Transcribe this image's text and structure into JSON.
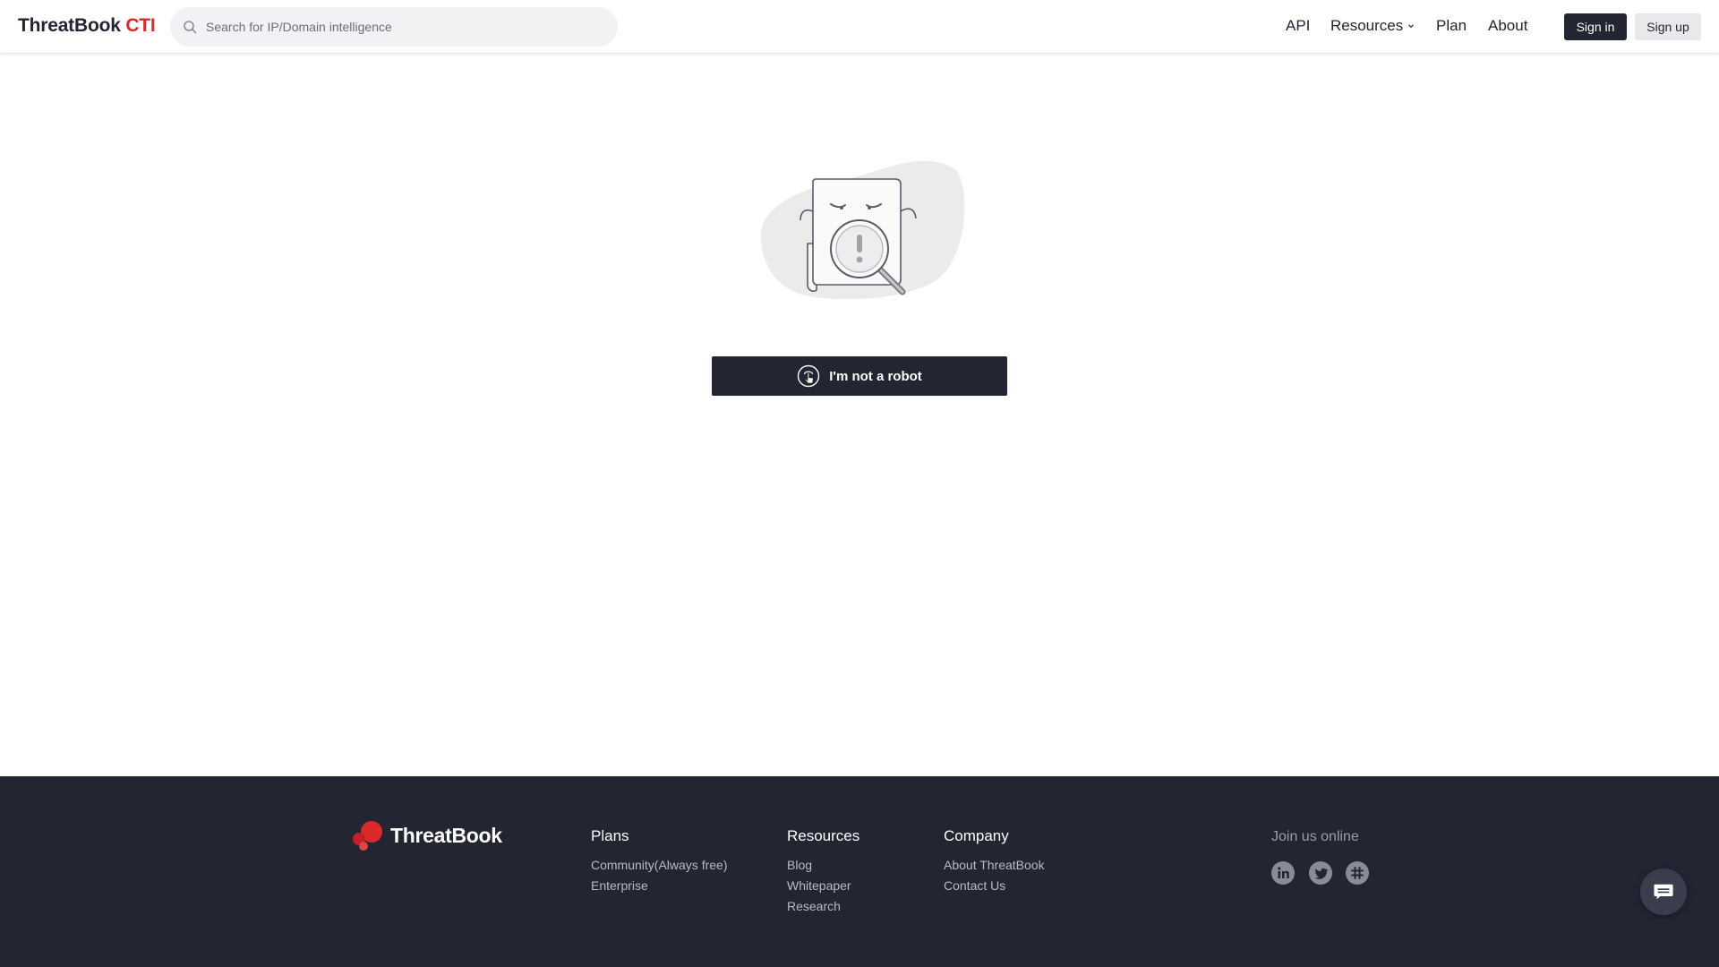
{
  "header": {
    "brand_main": "ThreatBook",
    "brand_accent": "CTI",
    "search_placeholder": "Search for IP/Domain intelligence",
    "nav": {
      "api": "API",
      "resources": "Resources",
      "plan": "Plan",
      "about": "About"
    },
    "signin_label": "Sign in",
    "signup_label": "Sign up"
  },
  "main": {
    "illustration_icon": "document-magnifier-warning",
    "robot_button_label": "I'm not a robot",
    "robot_button_icon": "pointer-hand-icon"
  },
  "footer": {
    "logo_text": "ThreatBook",
    "plans": {
      "title": "Plans",
      "links": [
        "Community(Always free)",
        "Enterprise"
      ]
    },
    "resources": {
      "title": "Resources",
      "links": [
        "Blog",
        "Whitepaper",
        "Research"
      ]
    },
    "company": {
      "title": "Company",
      "links": [
        "About ThreatBook",
        "Contact Us"
      ]
    },
    "join_label": "Join us online",
    "social_icons": [
      "linkedin-icon",
      "twitter-icon",
      "slack-icon"
    ]
  },
  "colors": {
    "dark": "#232533",
    "accent_red": "#d92b2b",
    "footer_link": "#b9bbc4"
  }
}
